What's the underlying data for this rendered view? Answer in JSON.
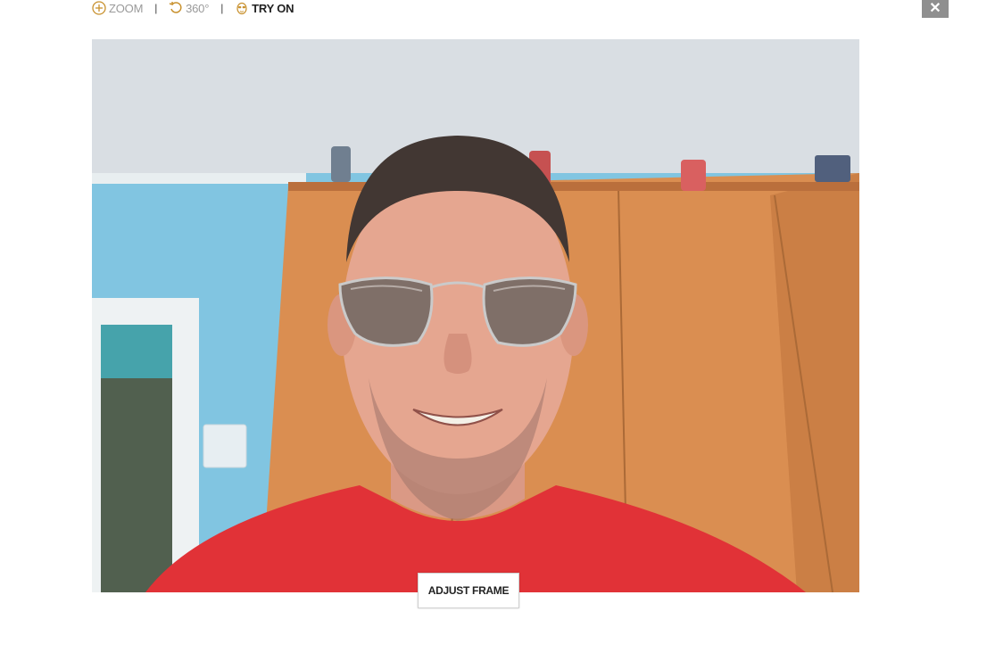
{
  "toolbar": {
    "zoom_label": "ZOOM",
    "rotate_label": "360°",
    "tryon_label": "TRY ON",
    "separator": "|"
  },
  "close_label": "✕",
  "camera": {
    "adjust_frame_label": "ADJUST FRAME"
  },
  "colors": {
    "accent": "#c8912e",
    "wall": "#7cc3e0",
    "cabinet": "#d98a4a",
    "shirt": "#e02a2f"
  },
  "icons": {
    "zoom": "plus-circle-icon",
    "rotate": "rotate-icon",
    "tryon": "face-icon",
    "close": "close-icon"
  }
}
